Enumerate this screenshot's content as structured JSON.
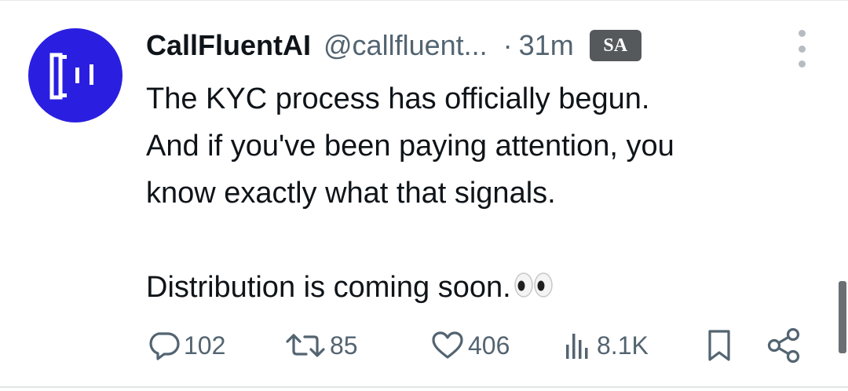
{
  "tweet": {
    "display_name": "CallFluentAI",
    "handle": "@callfluent...",
    "separator": "·",
    "time": "31m",
    "badge": "SA",
    "body_lines": [
      "The KYC process has officially begun.",
      "And if you've been paying attention, you",
      "know exactly what that signals.",
      "",
      "Distribution is coming soon."
    ],
    "emoji": "eyes-emoji"
  },
  "actions": {
    "replies": "102",
    "reposts": "85",
    "likes": "406",
    "views": "8.1K"
  },
  "icons": {
    "reply": "speech-bubble-icon",
    "repost": "repost-icon",
    "like": "heart-icon",
    "views": "bar-chart-icon",
    "bookmark": "bookmark-icon",
    "share": "share-icon",
    "more": "more-vertical-icon"
  },
  "colors": {
    "avatar_bg": "#2a1fe0",
    "muted_text": "#536471",
    "primary_text": "#0f1419",
    "badge_bg": "#55595c"
  }
}
